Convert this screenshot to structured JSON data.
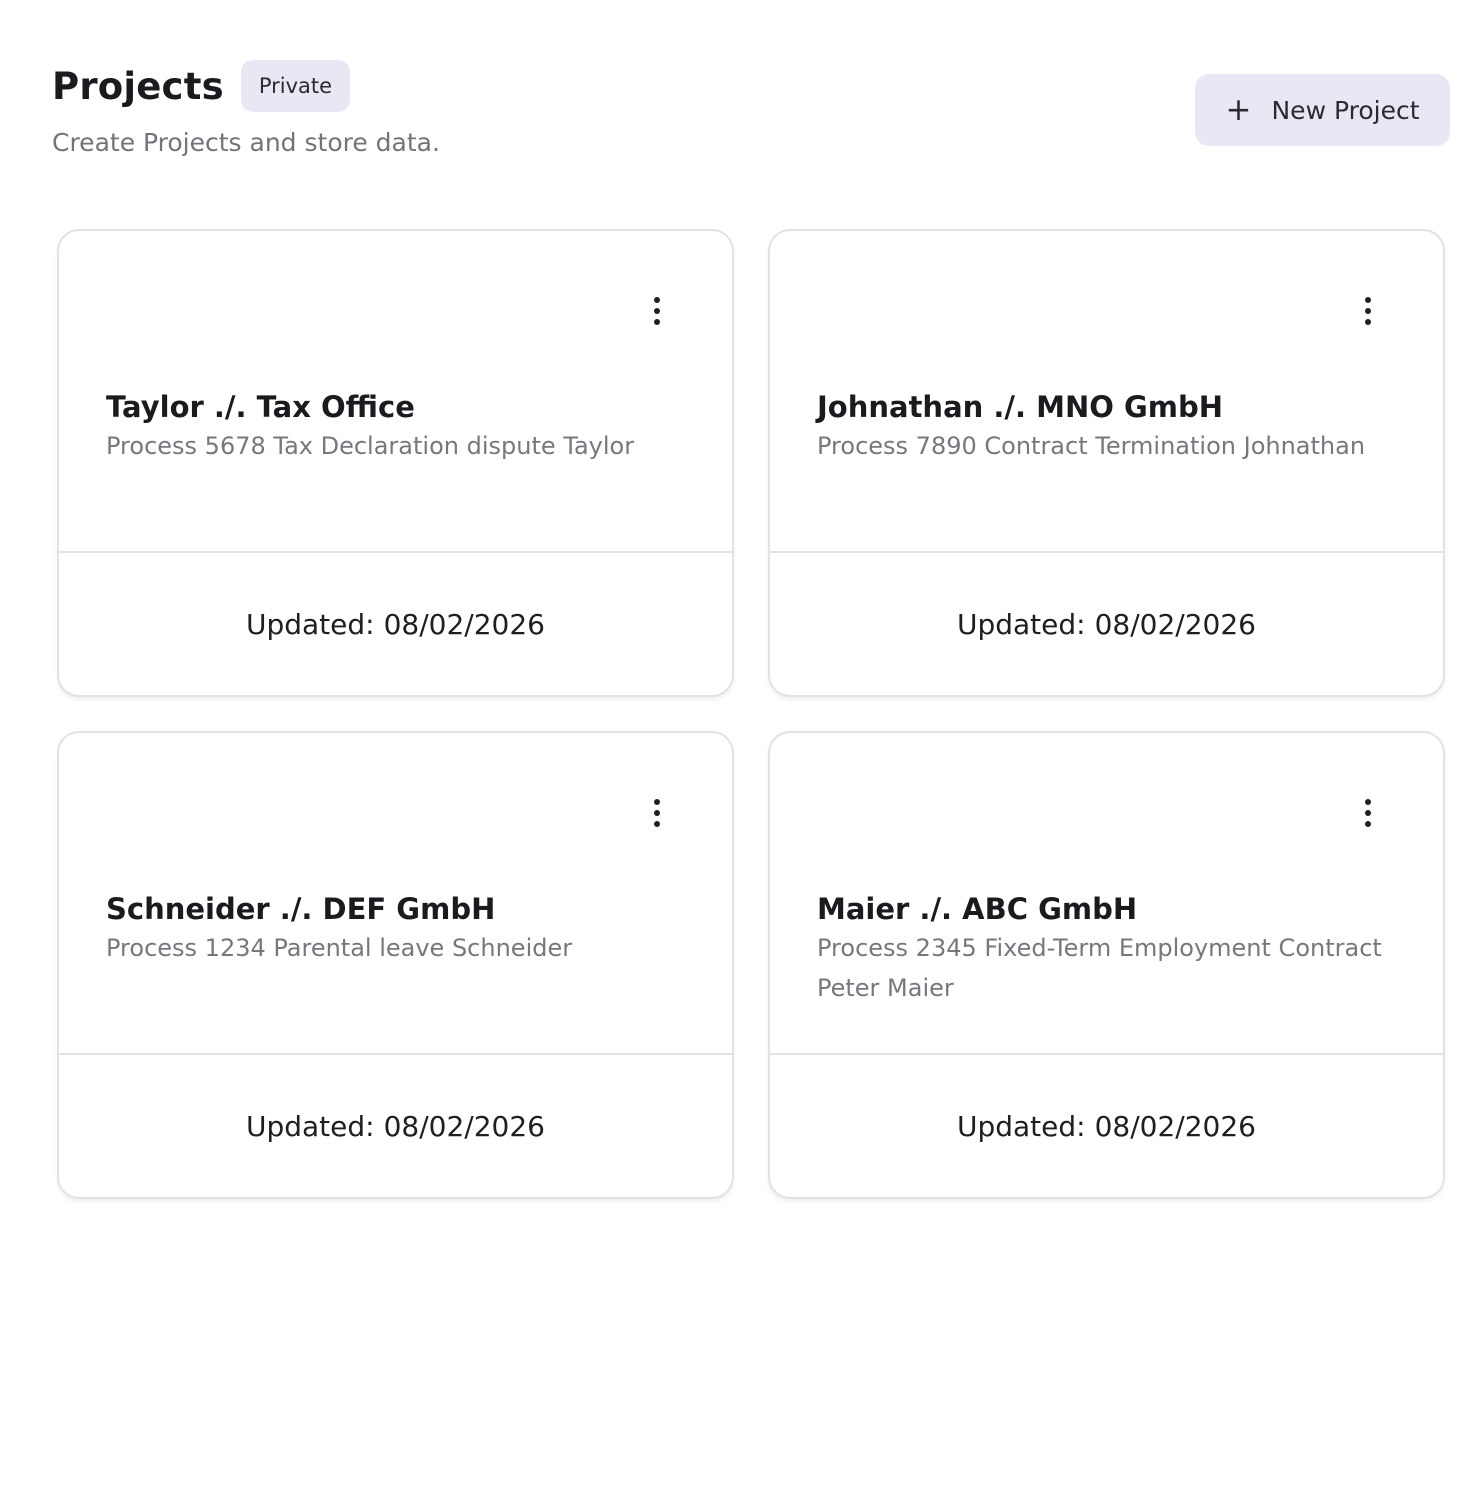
{
  "header": {
    "title": "Projects",
    "badge": "Private",
    "subtitle": "Create Projects and store data."
  },
  "actions": {
    "new_project_icon": "plus-icon",
    "new_project_label": "New Project"
  },
  "projects": [
    {
      "title": "Taylor ./. Tax Office",
      "description": "Process 5678 Tax Declaration dispute Taylor",
      "updated_label": "Updated:",
      "updated_date": "08/02/2026"
    },
    {
      "title": "Johnathan ./. MNO GmbH",
      "description": "Process 7890 Contract Termination Johnathan",
      "updated_label": "Updated:",
      "updated_date": "08/02/2026"
    },
    {
      "title": "Schneider ./. DEF GmbH",
      "description": "Process 1234 Parental leave Schneider",
      "updated_label": "Updated:",
      "updated_date": "08/02/2026"
    },
    {
      "title": "Maier ./. ABC GmbH",
      "description": "Process 2345 Fixed-Term Employment Contract Peter Maier",
      "updated_label": "Updated:",
      "updated_date": "08/02/2026"
    }
  ],
  "icons": {
    "card_menu": "more-vertical-icon"
  },
  "colors": {
    "accent_bg": "#e7e8f3",
    "card_border": "#e2e2e6",
    "muted_text": "#77777e"
  }
}
